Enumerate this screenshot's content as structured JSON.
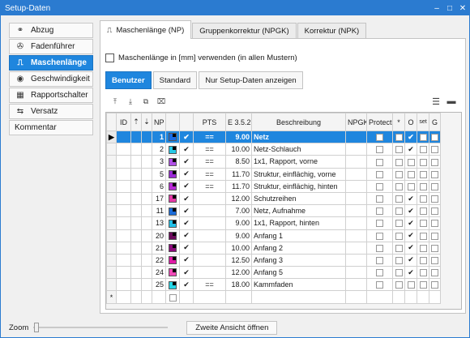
{
  "window": {
    "title": "Setup-Daten",
    "minimize": "–",
    "restore": "□",
    "close": "✕"
  },
  "sidebar": {
    "items": [
      {
        "label": "Abzug",
        "icon": "chain-icon",
        "glyph": "⚭"
      },
      {
        "label": "Fadenführer",
        "icon": "thread-guide-icon",
        "glyph": "✇"
      },
      {
        "label": "Maschenlänge",
        "icon": "stitch-length-icon",
        "glyph": "⎍",
        "active": true
      },
      {
        "label": "Geschwindigkeit",
        "icon": "speed-icon",
        "glyph": "◉"
      },
      {
        "label": "Rapportschalter",
        "icon": "report-switch-icon",
        "glyph": "▦"
      },
      {
        "label": "Versatz",
        "icon": "offset-icon",
        "glyph": "⇆"
      },
      {
        "label": "Kommentar",
        "icon": "",
        "glyph": ""
      }
    ]
  },
  "tabs": [
    {
      "label": "Maschenlänge (NP)",
      "glyph": "⎍",
      "active": true
    },
    {
      "label": "Gruppenkorrektur (NPGK)"
    },
    {
      "label": "Korrektur (NPK)"
    }
  ],
  "option": {
    "label": "Maschenlänge in [mm] verwenden (in allen Mustern)"
  },
  "buttons": [
    "Benutzer",
    "Standard",
    "Nur Setup-Daten anzeigen"
  ],
  "grid": {
    "headers": [
      "ID",
      "",
      "NP",
      "",
      "",
      "PTS",
      "E 3.5.2",
      "Beschreibung",
      "NPGK",
      "Protect",
      "*",
      "O",
      "set",
      "G"
    ],
    "rows": [
      {
        "np": "1",
        "color": "#1a6ae0",
        "pts": "==",
        "e": "9.00",
        "desc": "Netz",
        "o": true,
        "sel": true
      },
      {
        "np": "2",
        "color": "#27c9e6",
        "pts": "==",
        "e": "10.00",
        "desc": "Netz-Schlauch",
        "o": true
      },
      {
        "np": "3",
        "color": "#b050e6",
        "pts": "==",
        "e": "8.50",
        "desc": "1x1, Rapport, vorne",
        "o": false
      },
      {
        "np": "5",
        "color": "#9a2ad6",
        "pts": "==",
        "e": "11.70",
        "desc": "Struktur, einflächig, vorne",
        "o": false
      },
      {
        "np": "6",
        "color": "#b82ad6",
        "pts": "==",
        "e": "11.70",
        "desc": "Struktur, einflächig, hinten",
        "o": false
      },
      {
        "np": "17",
        "color": "#e43aa6",
        "pts": "",
        "e": "12.00",
        "desc": "Schutzreihen",
        "o": true
      },
      {
        "np": "11",
        "color": "#1c6cd8",
        "pts": "",
        "e": "7.00",
        "desc": "Netz, Aufnahme",
        "o": true
      },
      {
        "np": "13",
        "color": "#22c0e8",
        "pts": "",
        "e": "9.00",
        "desc": "1x1, Rapport, hinten",
        "o": true
      },
      {
        "np": "20",
        "color": "#6a0a5a",
        "pts": "",
        "e": "9.00",
        "desc": "Anfang 1",
        "o": true
      },
      {
        "np": "21",
        "color": "#8a0a7a",
        "pts": "",
        "e": "10.00",
        "desc": "Anfang 2",
        "o": true
      },
      {
        "np": "22",
        "color": "#e01aa6",
        "pts": "",
        "e": "12.50",
        "desc": "Anfang 3",
        "o": true
      },
      {
        "np": "24",
        "color": "#f04ab8",
        "pts": "",
        "e": "12.00",
        "desc": "Anfang 5",
        "o": true
      },
      {
        "np": "25",
        "color": "#27d6e6",
        "pts": "==",
        "e": "18.00",
        "desc": "Kammfaden",
        "o": false
      }
    ],
    "new_row_marker": "*"
  },
  "footer": {
    "zoom_label": "Zoom",
    "open_button": "Zweite Ansicht öffnen"
  }
}
